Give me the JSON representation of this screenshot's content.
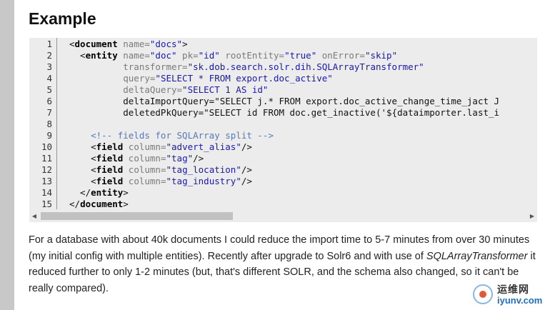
{
  "page": {
    "heading": "Example"
  },
  "code": {
    "line_numbers": [
      "1",
      "2",
      "3",
      "4",
      "5",
      "6",
      "7",
      "8",
      "9",
      "10",
      "11",
      "12",
      "13",
      "14",
      "15"
    ],
    "lines": [
      [
        {
          "t": "<",
          "c": "bracket"
        },
        {
          "t": "document",
          "c": "tag"
        },
        {
          "t": " name=",
          "c": "attr"
        },
        {
          "t": "\"docs\"",
          "c": "value"
        },
        {
          "t": ">",
          "c": "bracket"
        }
      ],
      [
        {
          "t": "  <",
          "c": "bracket"
        },
        {
          "t": "entity",
          "c": "tag"
        },
        {
          "t": " name=",
          "c": "attr"
        },
        {
          "t": "\"doc\"",
          "c": "value"
        },
        {
          "t": " pk=",
          "c": "attr"
        },
        {
          "t": "\"id\"",
          "c": "value"
        },
        {
          "t": " rootEntity=",
          "c": "attr"
        },
        {
          "t": "\"true\"",
          "c": "value"
        },
        {
          "t": " onError=",
          "c": "attr"
        },
        {
          "t": "\"skip\"",
          "c": "value"
        }
      ],
      [
        {
          "t": "          transformer=",
          "c": "attr"
        },
        {
          "t": "\"sk.dob.search.solr.dih.SQLArrayTransformer\"",
          "c": "value"
        }
      ],
      [
        {
          "t": "          query=",
          "c": "attr"
        },
        {
          "t": "\"SELECT * FROM export.doc_active\"",
          "c": "value"
        }
      ],
      [
        {
          "t": "          deltaQuery=",
          "c": "attr"
        },
        {
          "t": "\"SELECT 1 AS id\"",
          "c": "value"
        }
      ],
      [
        {
          "t": "          deltaImportQuery=\"SELECT j.* FROM export.doc_active_change_time_jact J",
          "c": "plain"
        }
      ],
      [
        {
          "t": "          deletedPkQuery=\"SELECT id FROM doc.get_inactive('${dataimporter.last_i",
          "c": "plain"
        }
      ],
      [],
      [
        {
          "t": "    <!-- fields for SQLArray split -->",
          "c": "comment"
        }
      ],
      [
        {
          "t": "    <",
          "c": "bracket"
        },
        {
          "t": "field",
          "c": "tag"
        },
        {
          "t": " column=",
          "c": "attr"
        },
        {
          "t": "\"advert_alias\"",
          "c": "value"
        },
        {
          "t": "/>",
          "c": "bracket"
        }
      ],
      [
        {
          "t": "    <",
          "c": "bracket"
        },
        {
          "t": "field",
          "c": "tag"
        },
        {
          "t": " column=",
          "c": "attr"
        },
        {
          "t": "\"tag\"",
          "c": "value"
        },
        {
          "t": "/>",
          "c": "bracket"
        }
      ],
      [
        {
          "t": "    <",
          "c": "bracket"
        },
        {
          "t": "field",
          "c": "tag"
        },
        {
          "t": " column=",
          "c": "attr"
        },
        {
          "t": "\"tag_location\"",
          "c": "value"
        },
        {
          "t": "/>",
          "c": "bracket"
        }
      ],
      [
        {
          "t": "    <",
          "c": "bracket"
        },
        {
          "t": "field",
          "c": "tag"
        },
        {
          "t": " column=",
          "c": "attr"
        },
        {
          "t": "\"tag_industry\"",
          "c": "value"
        },
        {
          "t": "/>",
          "c": "bracket"
        }
      ],
      [
        {
          "t": "  </",
          "c": "bracket"
        },
        {
          "t": "entity",
          "c": "tag"
        },
        {
          "t": ">",
          "c": "bracket"
        }
      ],
      [
        {
          "t": "</",
          "c": "bracket"
        },
        {
          "t": "document",
          "c": "tag"
        },
        {
          "t": ">",
          "c": "bracket"
        }
      ]
    ],
    "scroll_left_glyph": "◀",
    "scroll_right_glyph": "▶"
  },
  "paragraph": {
    "before": "For a database with about 40k documents I could reduce the import time to 5-7 minutes from over 30 minutes (my initial config with multiple entities). Recently after upgrade to Solr6 and with use of ",
    "emphasis": "SQLArrayTransformer",
    "after": " it reduced further to only 1-2 minutes (but, that's different SOLR, and the schema also changed, so it can't be really compared)."
  },
  "watermark": {
    "chinese": "运维网",
    "domain": "iyunv.com"
  },
  "colors": {
    "code_background": "#ececec",
    "gutter": "#c8c8c8",
    "line_separator": "#6ca0dc",
    "string_value": "#1a1aa6",
    "comment": "#5a78b4"
  }
}
